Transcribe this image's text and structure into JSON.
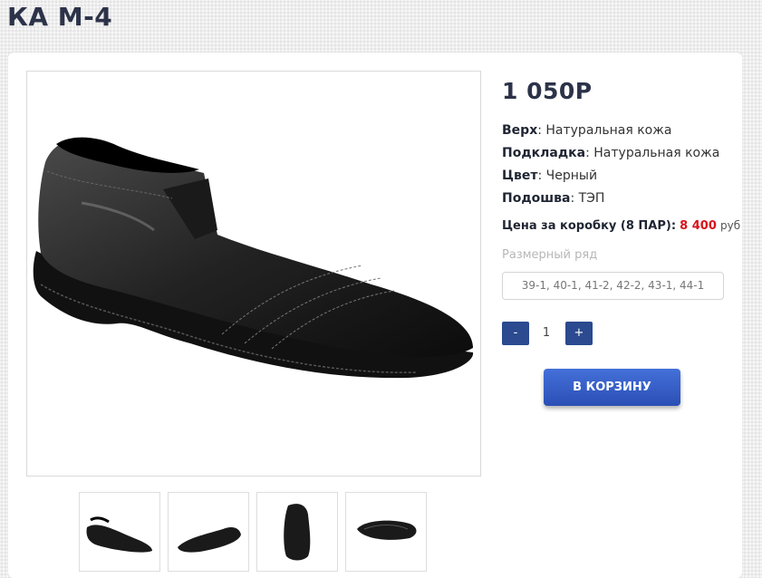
{
  "page": {
    "title": "КА М-4"
  },
  "product": {
    "price": "1 050Р",
    "specs": [
      {
        "label": "Верх",
        "value": ": Натуральная кожа"
      },
      {
        "label": "Подкладка",
        "value": ": Натуральная кожа"
      },
      {
        "label": "Цвет",
        "value": ": Черный"
      },
      {
        "label": "Подошва",
        "value": ": ТЭП"
      }
    ],
    "box_price": {
      "label": "Цена за коробку (8 ПАР):",
      "value": "8 400",
      "unit": "руб"
    },
    "size_range": {
      "label": "Размерный ряд",
      "value": "39-1, 40-1, 41-2, 42-2, 43-1, 44-1"
    },
    "quantity": {
      "minus": "-",
      "value": "1",
      "plus": "+"
    },
    "cart_button": "В КОРЗИНУ"
  },
  "thumbnails": [
    {
      "icon": "shoe-side-view"
    },
    {
      "icon": "shoe-angled-view"
    },
    {
      "icon": "shoe-front-view"
    },
    {
      "icon": "shoe-sole-view"
    }
  ],
  "colors": {
    "accent": "#2b4a8f",
    "cart": "#3a5fc6",
    "price_red": "#d8141c",
    "title": "#2c3349"
  }
}
